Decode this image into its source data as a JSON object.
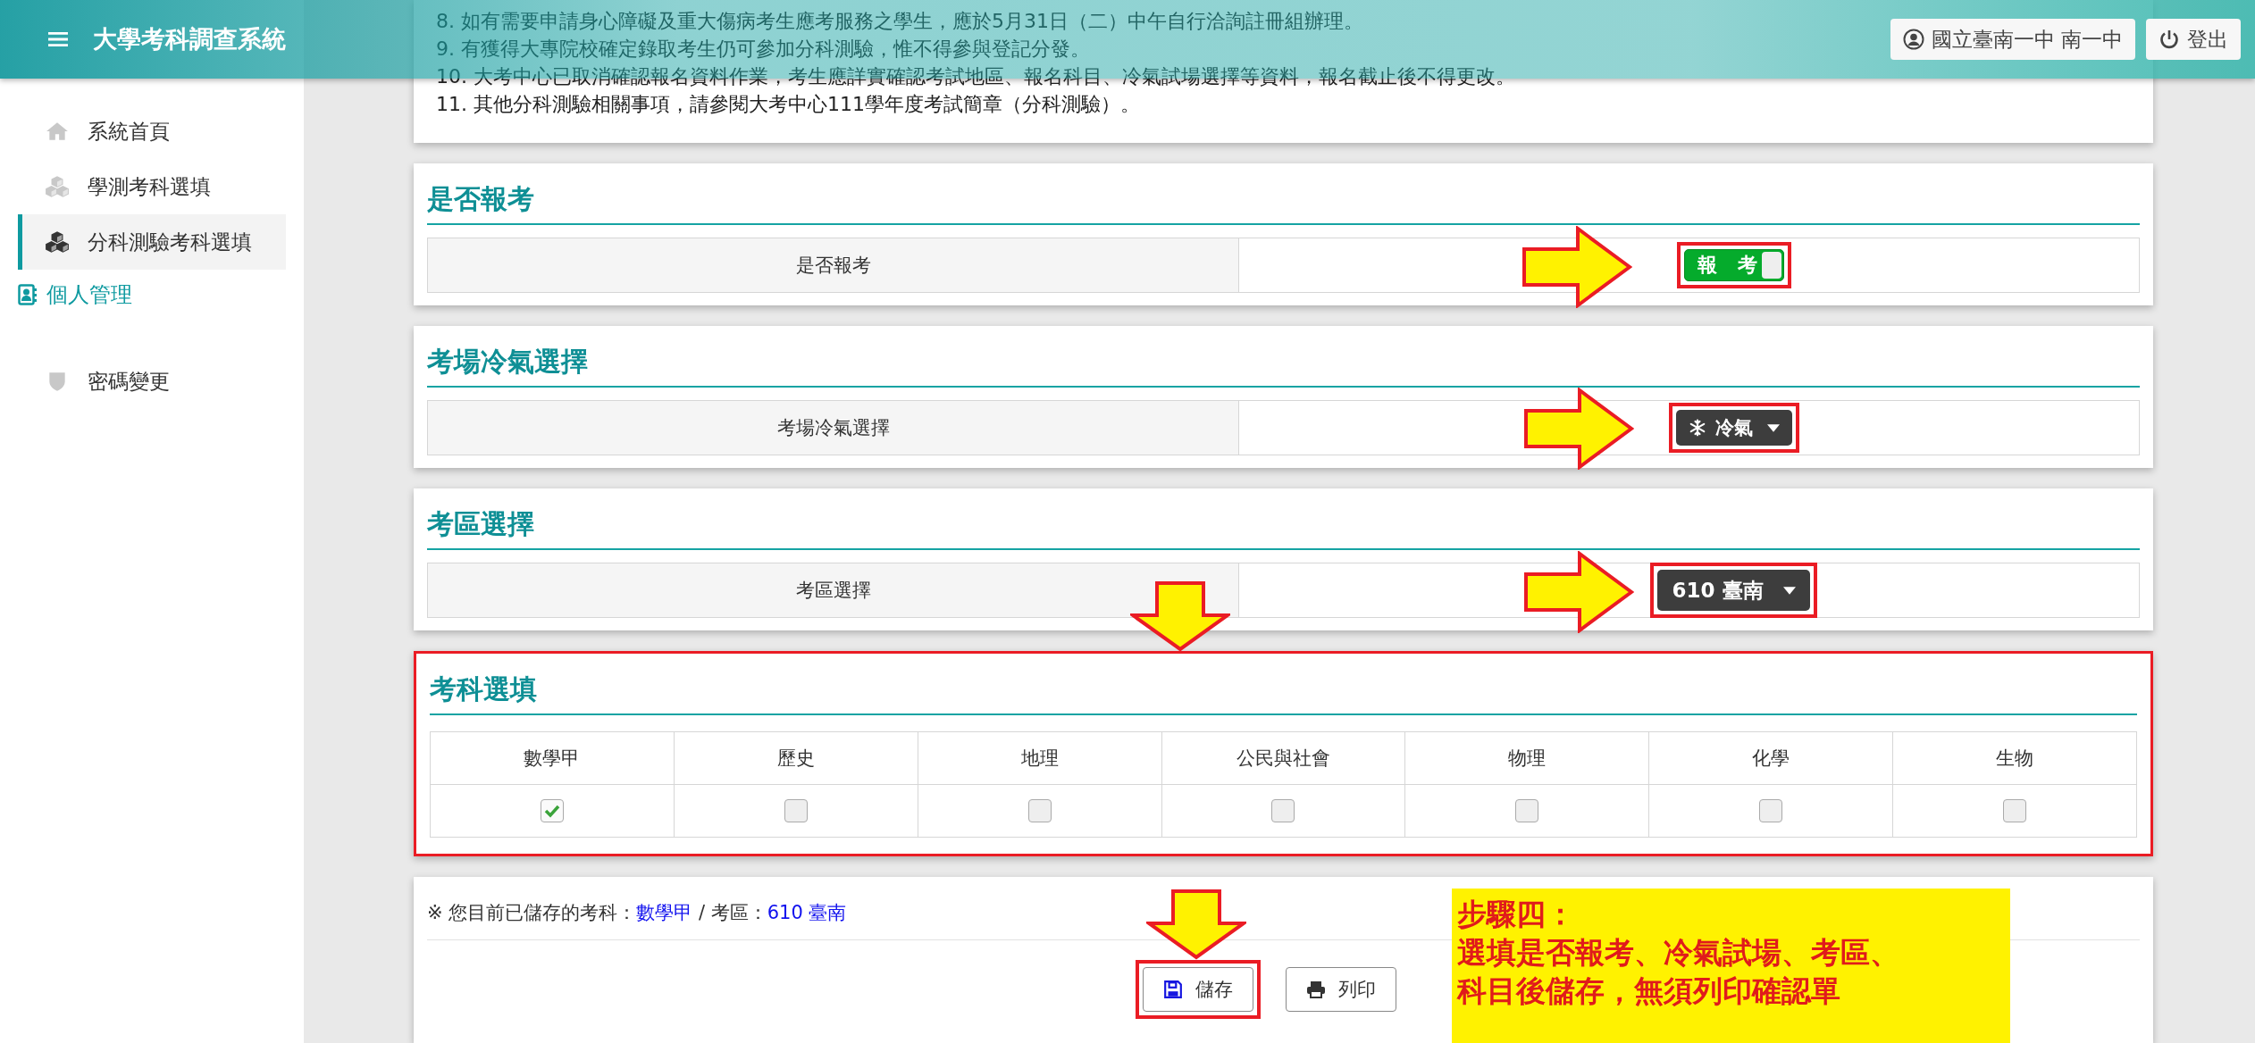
{
  "header": {
    "title": "大學考科調查系統",
    "user": "國立臺南一中 南一中",
    "logout": "登出"
  },
  "sidebar": {
    "items": [
      {
        "kind": "item",
        "label": "系統首頁",
        "selected": false
      },
      {
        "kind": "item",
        "label": "學測考科選填",
        "selected": false
      },
      {
        "kind": "item",
        "label": "分科測驗考科選填",
        "selected": true
      },
      {
        "kind": "section",
        "label": "個人管理",
        "selected": false
      },
      {
        "kind": "item",
        "label": "密碼變更",
        "selected": false
      }
    ]
  },
  "notices": [
    "8. 如有需要申請身心障礙及重大傷病考生應考服務之學生，應於5月31日（二）中午自行洽詢註冊組辦理。",
    "9. 有獲得大專院校確定錄取考生仍可參加分科測驗，惟不得參與登記分發。",
    "10. 大考中心已取消確認報名資料作業，考生應詳實確認考試地區、報名科目、冷氣試場選擇等資料，報名截止後不得更改。",
    "11. 其他分科測驗相關事項，請參閱大考中心111學年度考試簡章（分科測驗）。"
  ],
  "register": {
    "title": "是否報考",
    "label": "是否報考",
    "toggle": {
      "text": "報 考",
      "on": true
    }
  },
  "aircon": {
    "title": "考場冷氣選擇",
    "label": "考場冷氣選擇",
    "value": "冷氣"
  },
  "area": {
    "title": "考區選擇",
    "label": "考區選擇",
    "value": "610 臺南"
  },
  "subjects": {
    "title": "考科選填",
    "items": [
      {
        "name": "數學甲",
        "checked": true
      },
      {
        "name": "歷史",
        "checked": false
      },
      {
        "name": "地理",
        "checked": false
      },
      {
        "name": "公民與社會",
        "checked": false
      },
      {
        "name": "物理",
        "checked": false
      },
      {
        "name": "化學",
        "checked": false
      },
      {
        "name": "生物",
        "checked": false
      }
    ]
  },
  "summary": {
    "prefix": "※ 您目前已儲存的考科：",
    "subjects": "數學甲",
    "middle": " / 考區：",
    "area": "610 臺南"
  },
  "buttons": [
    {
      "kind": "save",
      "label": "儲存"
    },
    {
      "kind": "print",
      "label": "列印"
    }
  ],
  "annotation": {
    "lines": [
      "步驟四：",
      "選填是否報考、冷氣試場、考區、",
      "科目後儲存，無須列印確認單"
    ]
  }
}
